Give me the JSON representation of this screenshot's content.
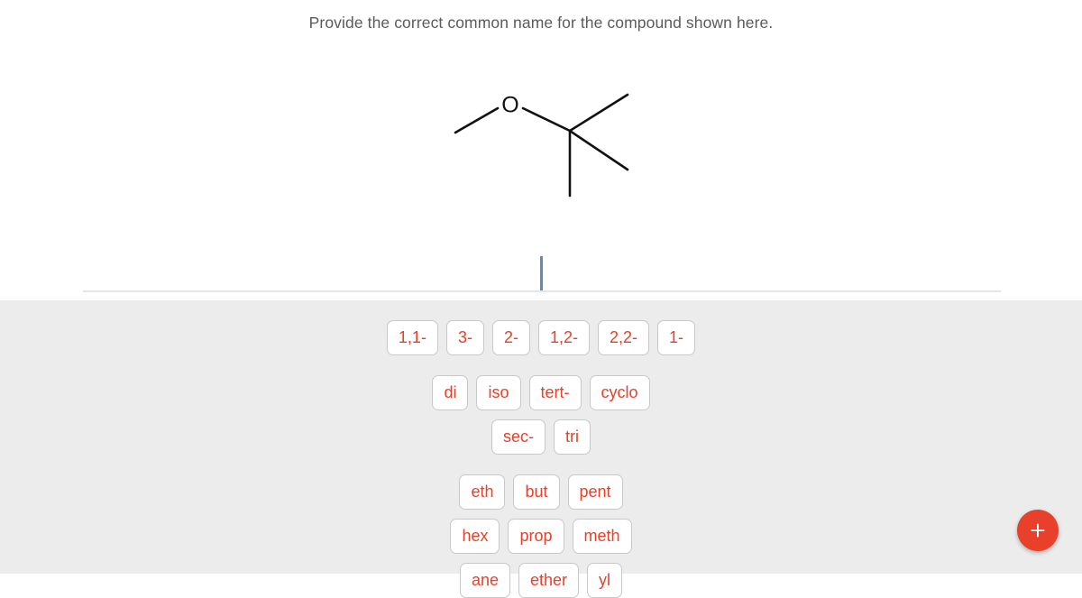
{
  "prompt": "Provide the correct common name for the compound shown here.",
  "structure": {
    "atom_labels": [
      "O"
    ],
    "description": "skeletal structure of methyl tert-butyl ether"
  },
  "answer_input": {
    "value": "",
    "caret_visible": true
  },
  "answer_bank": {
    "rows": [
      {
        "chips": [
          "1,1-",
          "3-",
          "2-",
          "1,2-",
          "2,2-",
          "1-"
        ]
      },
      {
        "chips": [
          "di",
          "iso",
          "tert-",
          "cyclo"
        ]
      },
      {
        "chips": [
          "sec-",
          "tri"
        ]
      },
      {
        "chips": [
          "eth",
          "but",
          "pent"
        ]
      },
      {
        "chips": [
          "hex",
          "prop",
          "meth"
        ]
      },
      {
        "chips": [
          "ane",
          "ether",
          "yl"
        ]
      }
    ]
  },
  "fab": {
    "label": "+",
    "color": "#e8402a"
  },
  "colors": {
    "accent": "#e8402a",
    "panel": "#ececec",
    "caret": "#5b8db8",
    "prompt_text": "#5b5b5b",
    "bond": "#111111"
  }
}
